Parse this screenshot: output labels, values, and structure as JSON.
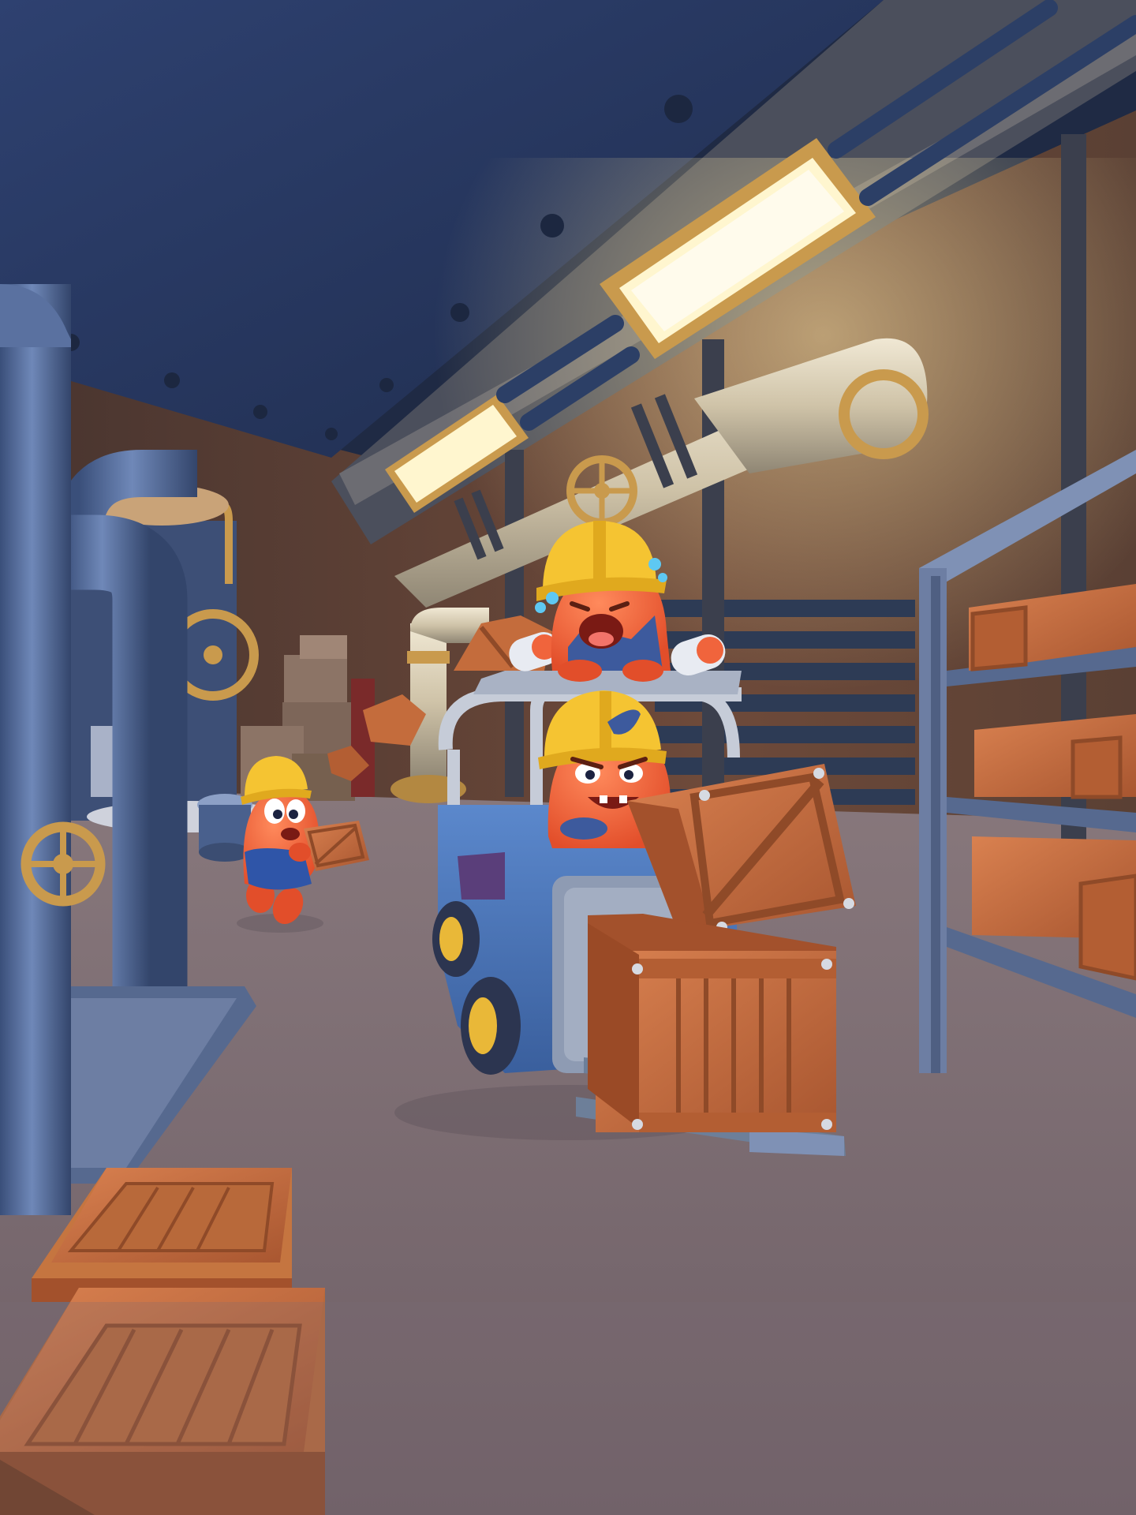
{
  "scene": {
    "setting": "warehouse-basement",
    "palette": {
      "ceiling": "#27385c",
      "wall": "#5a4034",
      "floor": "#9a8583",
      "pipe_blue": "#4d6491",
      "pipe_cream": "#d9cdb4",
      "brass": "#c99a4d",
      "lamp": "#fff6cf",
      "crate": "#c46c3c",
      "crate_dark": "#8f4a28",
      "forklift": "#4a74b8",
      "character": "#f0643c",
      "helmet": "#f5c432",
      "shelf": "#6d7ea3"
    },
    "characters": [
      {
        "name": "forklift-driver",
        "expression": "angry"
      },
      {
        "name": "crying-passenger",
        "expression": "crying"
      },
      {
        "name": "running-carrier",
        "expression": "surprised"
      }
    ]
  }
}
